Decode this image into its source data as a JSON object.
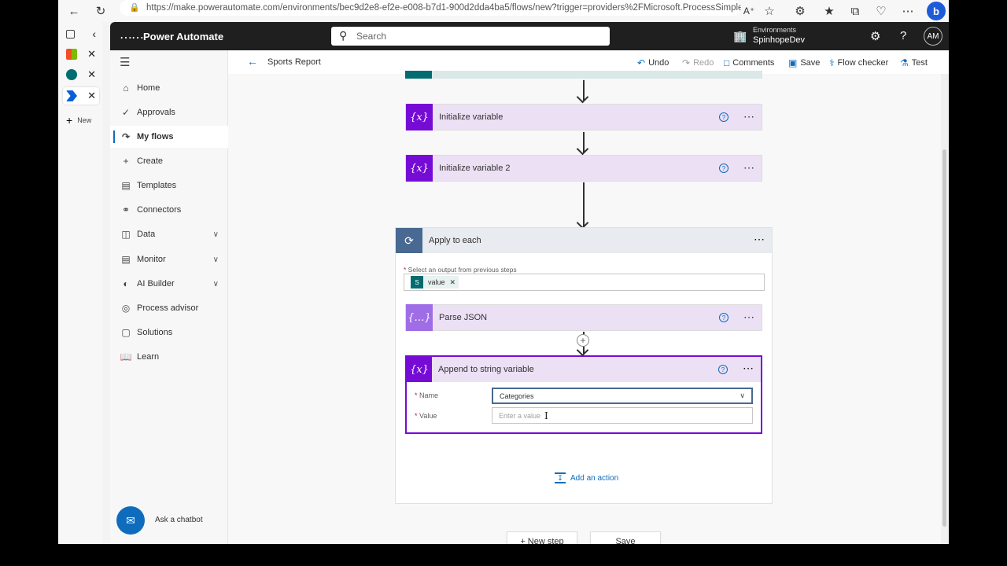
{
  "browser": {
    "url": "https://make.powerautomate.com/environments/bec9d2e8-ef2e-e008-b7d1-900d2dda4ba5/flows/new?trigger=providers%2FMicrosoft.ProcessSimple%2Foper…",
    "new_tab_label": "New"
  },
  "header": {
    "brand": "Power Automate",
    "search_placeholder": "Search",
    "env_label": "Environments",
    "env_name": "SpinhopeDev",
    "avatar_initials": "AM"
  },
  "nav": {
    "items": [
      {
        "label": "Home",
        "icon": "home-icon"
      },
      {
        "label": "Approvals",
        "icon": "approvals-icon"
      },
      {
        "label": "My flows",
        "icon": "flows-icon"
      },
      {
        "label": "Create",
        "icon": "plus-icon"
      },
      {
        "label": "Templates",
        "icon": "templates-icon"
      },
      {
        "label": "Connectors",
        "icon": "connectors-icon"
      },
      {
        "label": "Data",
        "icon": "data-icon"
      },
      {
        "label": "Monitor",
        "icon": "monitor-icon"
      },
      {
        "label": "AI Builder",
        "icon": "ai-builder-icon"
      },
      {
        "label": "Process advisor",
        "icon": "process-advisor-icon"
      },
      {
        "label": "Solutions",
        "icon": "solutions-icon"
      },
      {
        "label": "Learn",
        "icon": "learn-icon"
      }
    ],
    "chatbot_label": "Ask a chatbot"
  },
  "commandbar": {
    "title": "Sports Report",
    "undo": "Undo",
    "redo": "Redo",
    "comments": "Comments",
    "save": "Save",
    "flow_checker": "Flow checker",
    "test": "Test"
  },
  "flow": {
    "step1": "Initialize variable",
    "step2": "Initialize variable 2",
    "loop_title": "Apply to each",
    "loop_field_label": "Select an output from previous steps",
    "token_label": "value",
    "parse_json": "Parse JSON",
    "append_title": "Append to string variable",
    "name_label": "Name",
    "name_value": "Categories",
    "value_label": "Value",
    "value_placeholder": "Enter a value",
    "add_action": "Add an action",
    "new_step": "+ New step",
    "save": "Save"
  },
  "colors": {
    "variable_purple": "#770bd6",
    "loop_blue": "#486991",
    "accent": "#0f6cbd"
  }
}
